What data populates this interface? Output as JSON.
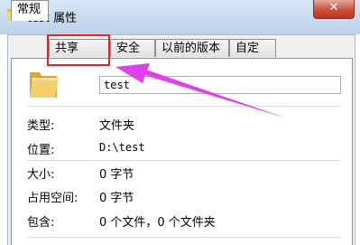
{
  "window": {
    "title": "test 属性",
    "close_label": "✕"
  },
  "tabs": [
    {
      "label": "常规",
      "active": true
    },
    {
      "label": "共享",
      "active": false
    },
    {
      "label": "安全",
      "active": false
    },
    {
      "label": "以前的版本",
      "active": false
    },
    {
      "label": "自定义",
      "active": false
    }
  ],
  "general": {
    "name_value": "test",
    "rows": [
      {
        "label": "类型:",
        "value": "文件夹"
      },
      {
        "label": "位置:",
        "value": "D:\\test"
      },
      {
        "label": "大小:",
        "value": "0 字节"
      },
      {
        "label": "占用空间:",
        "value": "0 字节"
      },
      {
        "label": "包含:",
        "value": "0 个文件，0 个文件夹"
      }
    ]
  },
  "annotation": {
    "highlight_color": "#e8202a",
    "arrow_color": "#e040e8"
  }
}
